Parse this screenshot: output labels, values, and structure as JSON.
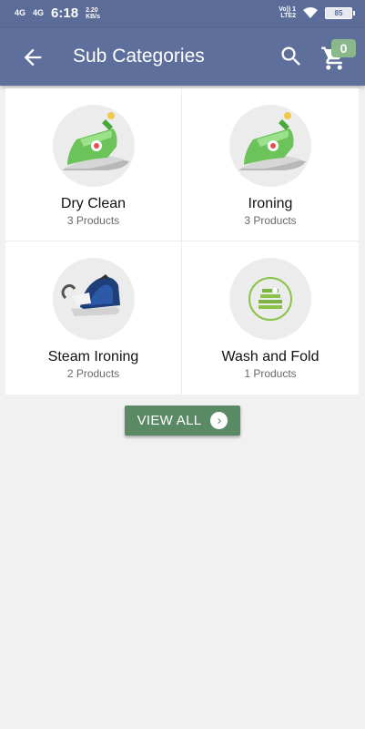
{
  "status_bar": {
    "network1": "4G",
    "network2": "4G",
    "time": "6:18",
    "speed_value": "2.20",
    "speed_unit": "KB/s",
    "volte_top": "Vo)) 1",
    "volte_bottom": "LTE2",
    "battery": "85"
  },
  "app_bar": {
    "title": "Sub Categories",
    "cart_count": "0"
  },
  "categories": [
    {
      "name": "Dry Clean",
      "count": "3 Products",
      "icon": "iron-icon"
    },
    {
      "name": "Ironing",
      "count": "3 Products",
      "icon": "iron-icon"
    },
    {
      "name": "Steam Ironing",
      "count": "2 Products",
      "icon": "steam-iron-icon"
    },
    {
      "name": "Wash and Fold",
      "count": "1 Products",
      "icon": "folded-clothes-icon"
    }
  ],
  "view_all": {
    "label": "VIEW ALL"
  },
  "colors": {
    "app_bar": "#5e6f9b",
    "accent_green": "#5a8a63",
    "badge_green": "#8ab88a",
    "background": "#f1f1f1"
  }
}
